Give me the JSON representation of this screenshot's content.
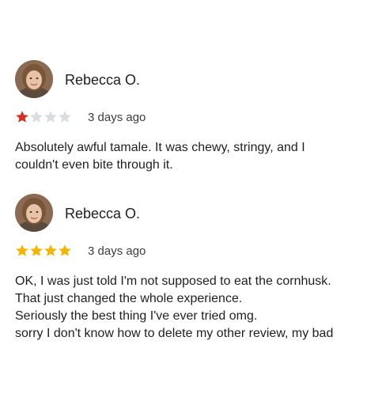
{
  "reviews": [
    {
      "author": "Rebecca O.",
      "rating": 1,
      "max_rating": 5,
      "date": "3 days ago",
      "lines": [
        "Absolutely awful tamale. It was chewy, stringy, and I",
        "couldn't even bite through it."
      ]
    },
    {
      "author": "Rebecca O.",
      "rating": 4,
      "max_rating": 5,
      "date": "3 days ago",
      "lines": [
        "OK, I was just told I'm not supposed to eat the cornhusk.",
        "That just changed the whole experience.",
        "Seriously the best thing I've ever tried omg.",
        "sorry I don't know how to delete my other review, my bad"
      ]
    }
  ],
  "colors": {
    "star_filled": "#f4b400",
    "star_filled_low": "#d93025",
    "star_empty": "#dadce0"
  },
  "icons": {
    "avatar": "person-photo-icon",
    "star": "star-icon"
  }
}
